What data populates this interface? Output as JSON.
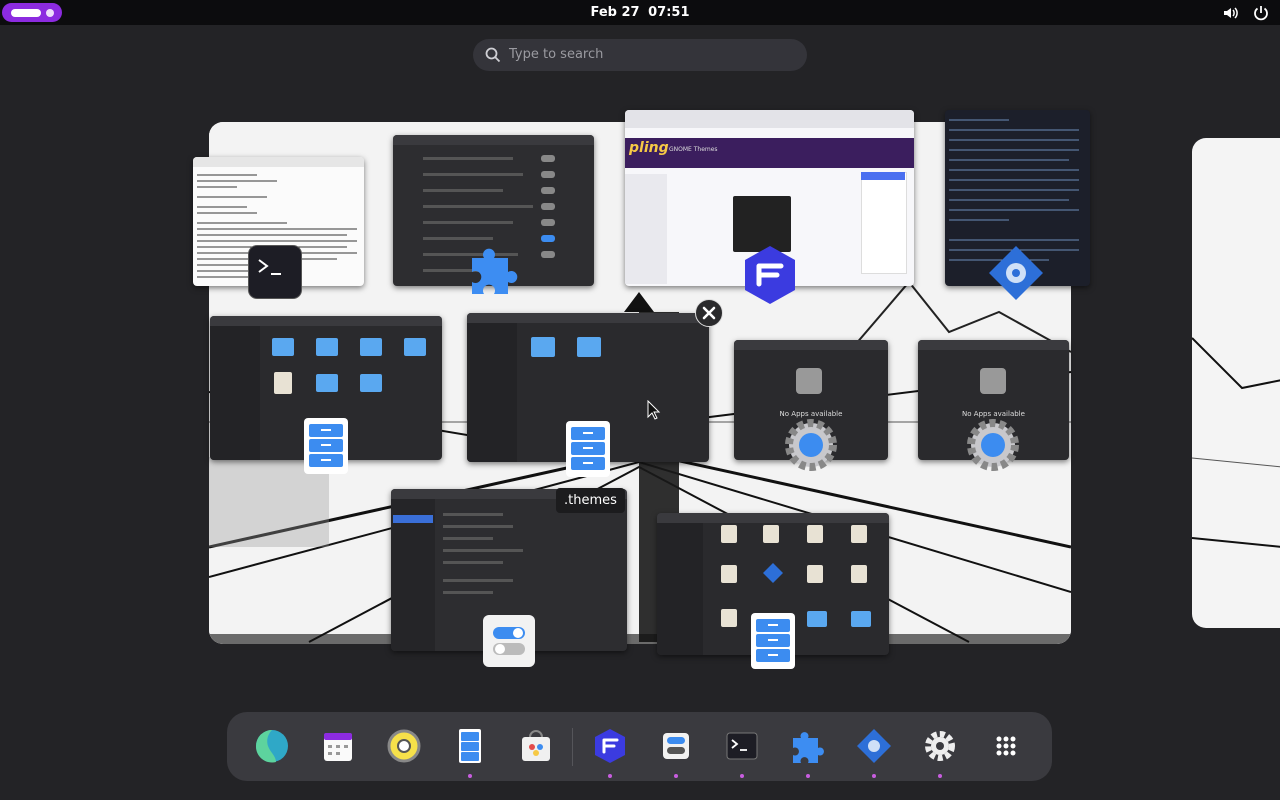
{
  "topbar": {
    "activities": "activities-indicator",
    "date": "Feb 27",
    "time": "07:51",
    "tray_icons": [
      "volume-icon",
      "power-icon"
    ]
  },
  "search": {
    "placeholder": "Type to search"
  },
  "overview": {
    "tooltip": ".themes",
    "close_icon": "close-icon",
    "windows": [
      {
        "name": "terminal-window",
        "app_icon": "terminal-icon"
      },
      {
        "name": "extensions-window",
        "app_icon": "puzzle-icon"
      },
      {
        "name": "browser-window",
        "app_icon": "flathub-icon",
        "heading": "GNOME Themes"
      },
      {
        "name": "terminal-window-2",
        "app_icon": "gear-icon"
      },
      {
        "name": "files-window-1",
        "app_icon": "files-icon"
      },
      {
        "name": "files-window-2",
        "app_icon": "files-icon",
        "title": ".themes"
      },
      {
        "name": "open-with-window-1",
        "app_icon": "gear-icon",
        "message": "No Apps available"
      },
      {
        "name": "open-with-window-2",
        "app_icon": "gear-icon",
        "message": "No Apps available"
      },
      {
        "name": "tweaks-window",
        "app_icon": "tweaks-icon"
      },
      {
        "name": "files-window-3",
        "app_icon": "files-icon"
      }
    ]
  },
  "dock": {
    "apps": [
      {
        "name": "browser-icon",
        "running": false
      },
      {
        "name": "calendar-icon",
        "running": false
      },
      {
        "name": "music-icon",
        "running": false
      },
      {
        "name": "files-icon",
        "running": true
      },
      {
        "name": "software-icon",
        "running": false
      },
      {
        "name": "flatseal-icon",
        "running": true
      },
      {
        "name": "tweaks-icon",
        "running": true
      },
      {
        "name": "terminal-icon",
        "running": true
      },
      {
        "name": "extensions-icon",
        "running": true
      },
      {
        "name": "gear-script-icon",
        "running": true
      },
      {
        "name": "settings-icon",
        "running": true
      },
      {
        "name": "app-grid-icon",
        "running": false
      }
    ]
  },
  "colors": {
    "accent": "#8c2be0",
    "folder": "#5aa8f0",
    "files_blue": "#3c8cf0"
  }
}
